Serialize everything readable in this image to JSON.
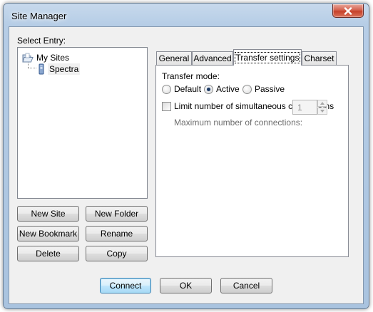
{
  "window": {
    "title": "Site Manager"
  },
  "left": {
    "select_entry_label": "Select Entry:",
    "tree": [
      {
        "label": "My Sites",
        "icon": "folder-open-icon",
        "selected": false
      },
      {
        "label": "Spectra",
        "icon": "server-icon",
        "selected": true
      }
    ],
    "buttons": {
      "new_site": "New Site",
      "new_folder": "New Folder",
      "new_bookmark": "New Bookmark",
      "rename": "Rename",
      "delete": "Delete",
      "copy": "Copy"
    }
  },
  "tabs": [
    {
      "label": "General",
      "active": false
    },
    {
      "label": "Advanced",
      "active": false
    },
    {
      "label": "Transfer settings",
      "active": true
    },
    {
      "label": "Charset",
      "active": false
    }
  ],
  "transfer": {
    "mode_label": "Transfer mode:",
    "modes": [
      {
        "label": "Default",
        "checked": false
      },
      {
        "label": "Active",
        "checked": true
      },
      {
        "label": "Passive",
        "checked": false
      }
    ],
    "limit_label": "Limit number of simultaneous connections",
    "limit_checked": false,
    "max_label": "Maximum number of connections:",
    "max_value": "1"
  },
  "footer": {
    "connect": "Connect",
    "ok": "OK",
    "cancel": "Cancel"
  },
  "colors": {
    "title_bar": "#b6cde6",
    "close_button": "#c7412b",
    "client_bg": "#f0f0f0",
    "default_button": "#bee6fd"
  }
}
